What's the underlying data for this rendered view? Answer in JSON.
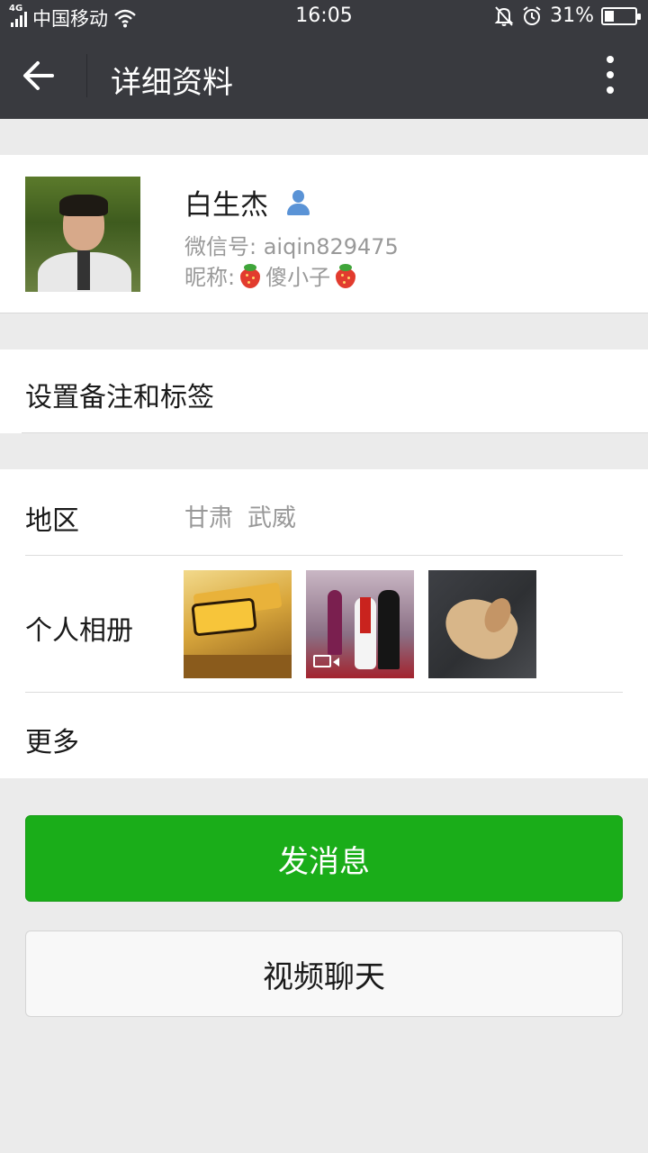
{
  "status_bar": {
    "network": "4G",
    "carrier": "中国移动",
    "time": "16:05",
    "battery": "31%",
    "battery_level": 0.31
  },
  "header": {
    "title": "详细资料"
  },
  "profile": {
    "name": "白生杰",
    "wechat_id": "微信号: aiqin829475",
    "nickname_label": "昵称:",
    "nickname": "傻小子"
  },
  "remark": {
    "label": "设置备注和标签"
  },
  "info": {
    "region_label": "地区",
    "region_province": "甘肃",
    "region_city": "武威",
    "album_label": "个人相册",
    "more_label": "更多"
  },
  "actions": {
    "send_message": "发消息",
    "video_chat": "视频聊天"
  },
  "colors": {
    "header_bg": "#393a3f",
    "primary_green": "#1aad19",
    "page_bg": "#ebebeb"
  }
}
